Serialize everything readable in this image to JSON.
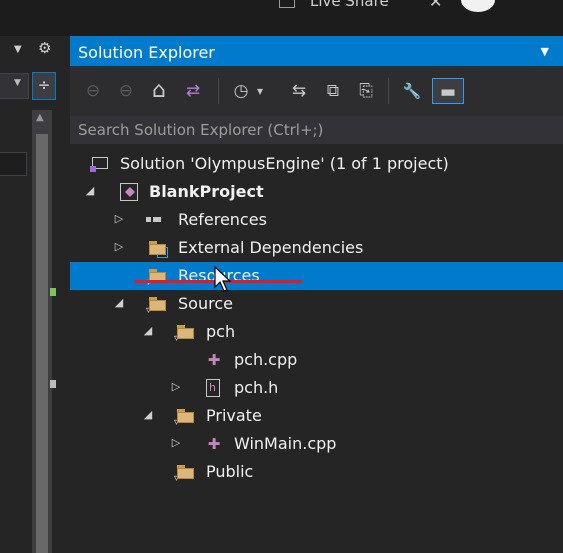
{
  "top_bar": {
    "live_share": "Live Share",
    "close_glyph": "✕"
  },
  "left_pane": {
    "menu_arrow": "▼",
    "gear_glyph": "⚙",
    "combo_arrow": "▼",
    "split_glyph": "÷",
    "scroll_up": "▲"
  },
  "solution_explorer": {
    "title": "Solution Explorer",
    "title_dropdown": "▼",
    "search_placeholder": "Search Solution Explorer (Ctrl+;)",
    "toolbar": {
      "back": "⊖",
      "forward": "⊖",
      "home": "⌂",
      "switch_views": "⇄",
      "history": "◷",
      "history_arrow": "▾",
      "sync": "⇆",
      "collapse_all": "⧉",
      "show_all": "⎘",
      "properties": "🔧",
      "preview": "▬"
    },
    "tree": [
      {
        "label": "Solution 'OlympusEngine' (1 of 1 project)",
        "icon": "solution-icon",
        "expander": "",
        "indent": 0
      },
      {
        "label": "BlankProject",
        "icon": "project-icon",
        "expander": "◢",
        "indent": 0,
        "bold": true
      },
      {
        "label": "References",
        "icon": "references-icon",
        "expander": "▷",
        "indent": 1
      },
      {
        "label": "External Dependencies",
        "icon": "external-dependencies-icon",
        "expander": "▷",
        "indent": 1
      },
      {
        "label": "Resources",
        "icon": "filter-folder-icon",
        "expander": "",
        "indent": 1,
        "selected": true
      },
      {
        "label": "Source",
        "icon": "filter-folder-icon",
        "expander": "◢",
        "indent": 1
      },
      {
        "label": "pch",
        "icon": "filter-folder-icon",
        "expander": "◢",
        "indent": 2
      },
      {
        "label": "pch.cpp",
        "icon": "cpp-file-icon",
        "expander": "",
        "indent": 3
      },
      {
        "label": "pch.h",
        "icon": "header-file-icon",
        "expander": "▷",
        "indent": 3
      },
      {
        "label": "Private",
        "icon": "filter-folder-icon",
        "expander": "◢",
        "indent": 2
      },
      {
        "label": "WinMain.cpp",
        "icon": "cpp-file-icon",
        "expander": "▷",
        "indent": 3
      },
      {
        "label": "Public",
        "icon": "filter-folder-icon",
        "expander": "",
        "indent": 2
      }
    ]
  },
  "colors": {
    "accent": "#007acc",
    "background": "#252526",
    "annotation_underline": "#e5191f"
  }
}
